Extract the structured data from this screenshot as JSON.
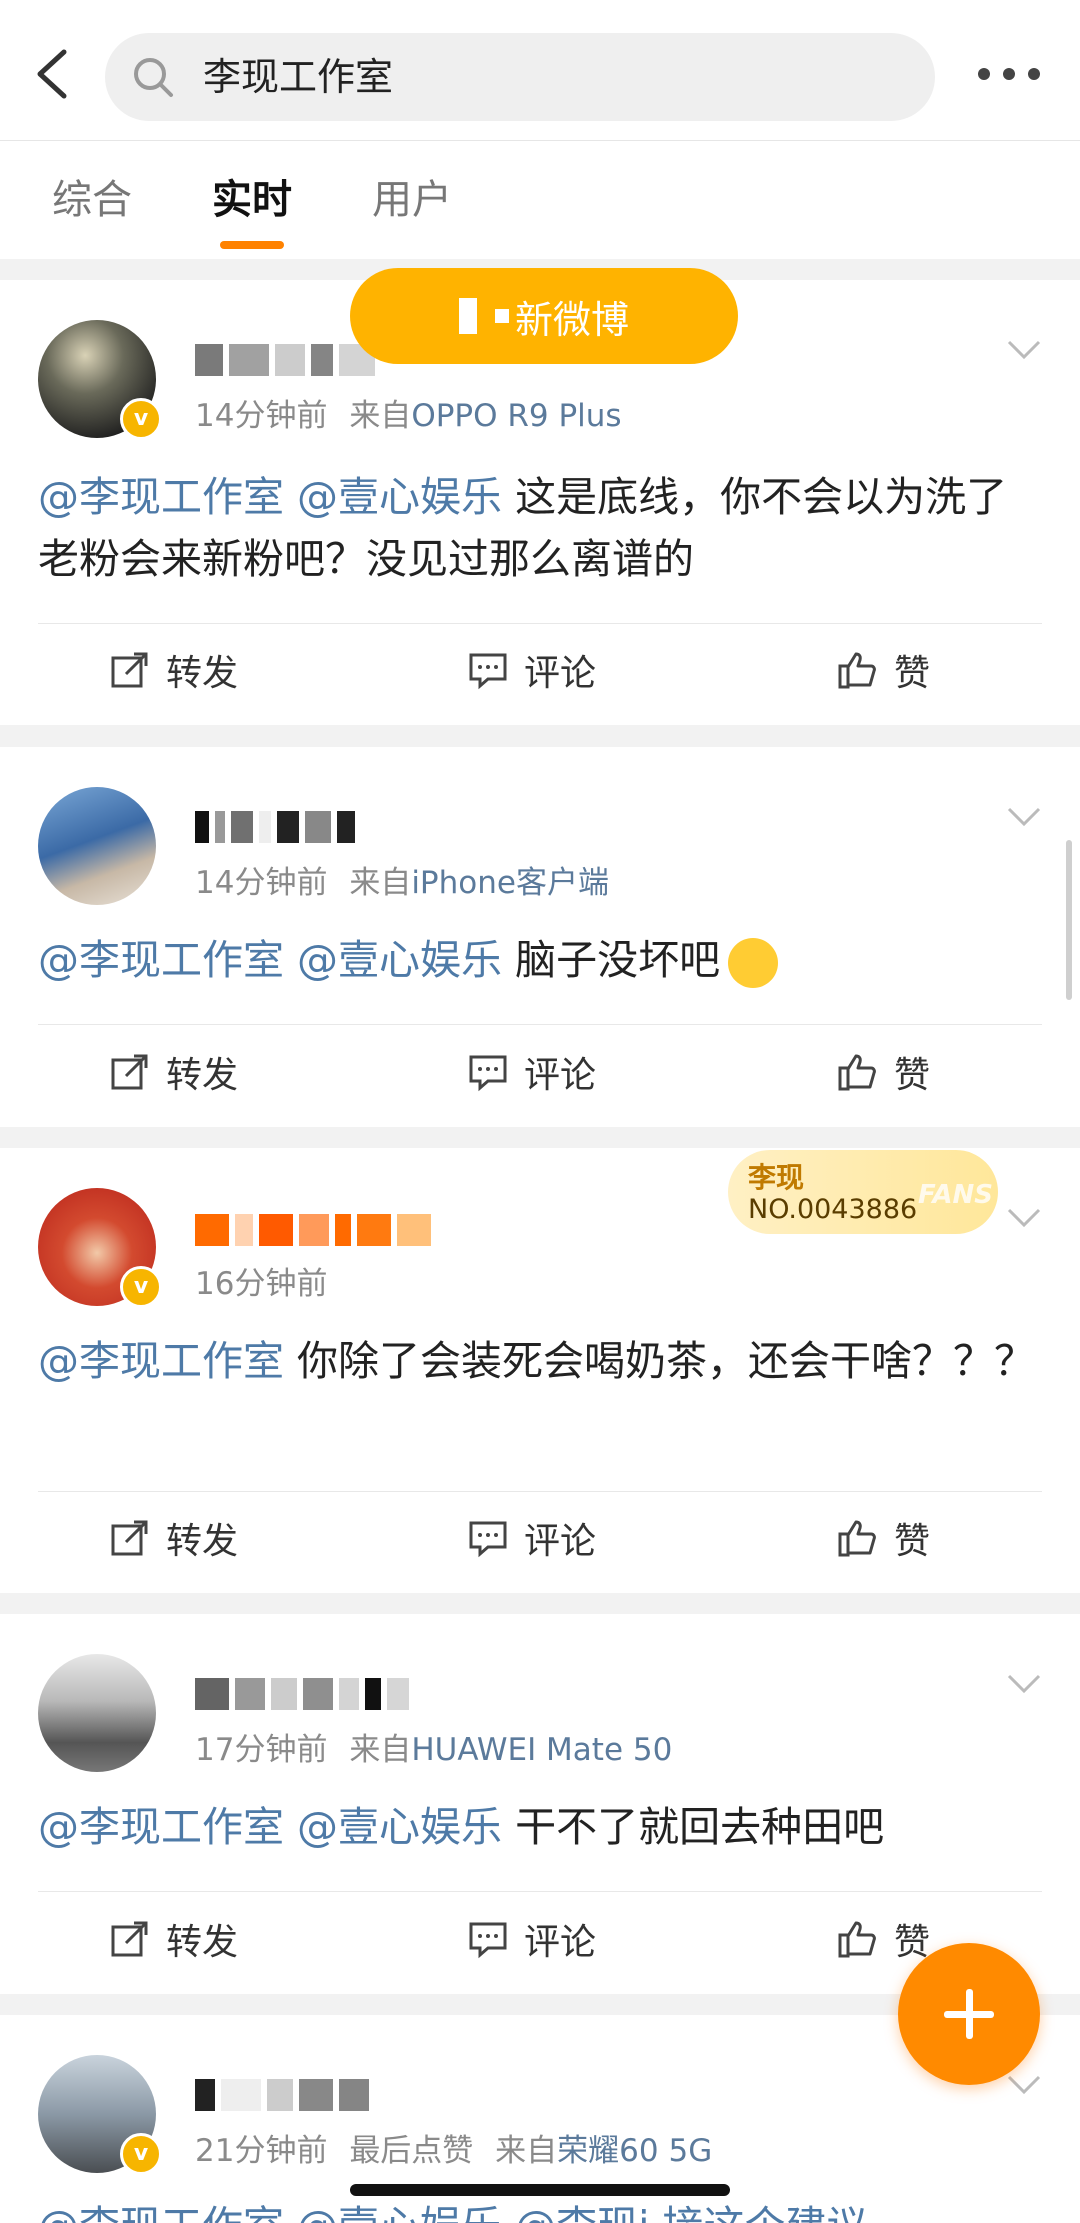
{
  "search": {
    "query": "李现工作室"
  },
  "tabs": [
    {
      "label": "综合"
    },
    {
      "label": "实时"
    },
    {
      "label": "用户"
    }
  ],
  "new_posts_label": "新微博",
  "actions": {
    "repost": "转发",
    "comment": "评论",
    "like": "赞"
  },
  "posts": [
    {
      "time": "14分钟前",
      "source_prefix": "来自",
      "source": "OPPO R9 Plus",
      "mentions": [
        "@李现工作室",
        "@壹心娱乐"
      ],
      "text": "这是底线，你不会以为洗了老粉会来新粉吧？没见过那么离谱的"
    },
    {
      "time": "14分钟前",
      "source_prefix": "来自",
      "source": "iPhone客户端",
      "mentions": [
        "@李现工作室",
        "@壹心娱乐"
      ],
      "text": "脑子没坏吧"
    },
    {
      "time": "16分钟前",
      "mentions": [
        "@李现工作室"
      ],
      "text": "你除了会装死会喝奶茶，还会干啥？？？",
      "fan_badge": {
        "name": "李现",
        "number": "NO.0043886",
        "tag": "FANS"
      }
    },
    {
      "time": "17分钟前",
      "source_prefix": "来自",
      "source": "HUAWEI Mate 50",
      "mentions": [
        "@李现工作室",
        "@壹心娱乐"
      ],
      "text": "干不了就回去种田吧"
    },
    {
      "time": "21分钟前",
      "extra": "最后点赞",
      "source_prefix": "来自",
      "source": "荣耀60 5G",
      "partial_text": "@李现工作室 @壹心娱乐 @李现i  接这个建议"
    }
  ],
  "colors": {
    "accent": "#ff8200",
    "link": "#4e7aa7",
    "badge": "#f7b500"
  }
}
